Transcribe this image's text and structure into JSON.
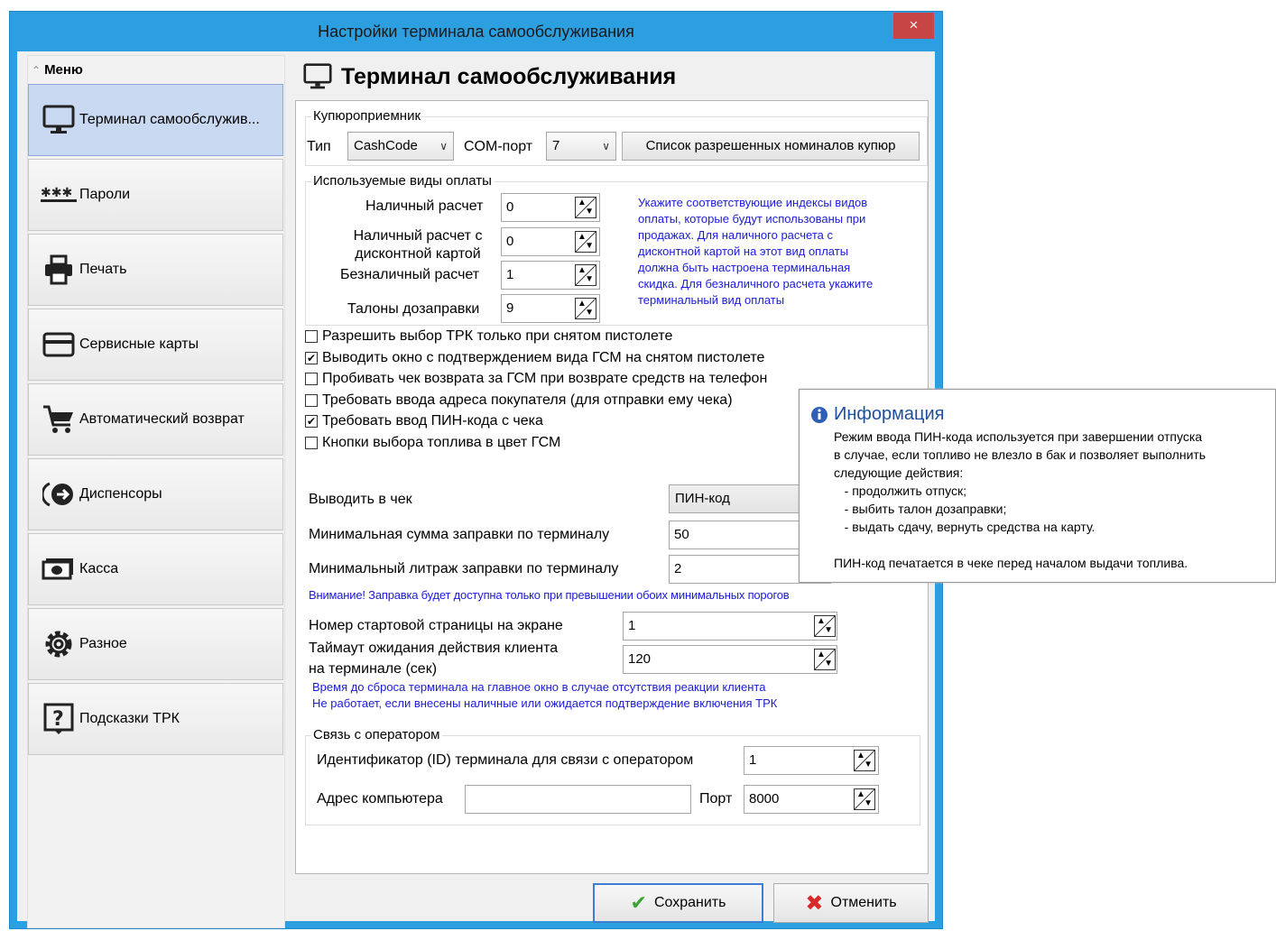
{
  "window": {
    "title": "Настройки терминала самообслуживания",
    "close_label": "×"
  },
  "sidebar": {
    "header": "Меню",
    "items": [
      {
        "label": "Терминал самообслужив...",
        "icon": "monitor-icon"
      },
      {
        "label": "Пароли",
        "icon": "password-icon"
      },
      {
        "label": "Печать",
        "icon": "printer-icon"
      },
      {
        "label": "Сервисные карты",
        "icon": "card-icon"
      },
      {
        "label": "Автоматический возврат",
        "icon": "cart-icon"
      },
      {
        "label": "Диспенсоры",
        "icon": "dispenser-icon"
      },
      {
        "label": "Касса",
        "icon": "money-icon"
      },
      {
        "label": "Разное",
        "icon": "gear-icon"
      },
      {
        "label": "Подсказки ТРК",
        "icon": "help-icon"
      }
    ]
  },
  "page": {
    "title": "Терминал самообслуживания"
  },
  "bill_acceptor": {
    "title": "Купюроприемник",
    "type_label": "Тип",
    "type_value": "CashCode",
    "com_label": "COM-порт",
    "com_value": "7",
    "denominations_button": "Список разрешенных номиналов купюр"
  },
  "payment_types": {
    "title": "Используемые виды оплаты",
    "rows": [
      {
        "label": "Наличный расчет",
        "value": "0"
      },
      {
        "label": "Наличный расчет с дисконтной картой",
        "value": "0"
      },
      {
        "label": "Безналичный расчет",
        "value": "1"
      },
      {
        "label": "Талоны дозаправки",
        "value": "9"
      }
    ],
    "note": "Укажите соответствующие индексы видов\nоплаты, которые будут использованы при\nпродажах. Для наличного расчета с\nдисконтной картой на этот вид оплаты\nдолжна быть настроена терминальная\nскидка. Для безналичного расчета укажите\nтерминальный вид оплаты"
  },
  "checkboxes": [
    {
      "label": "Разрешить выбор ТРК только при снятом пистолете",
      "checked": false
    },
    {
      "label": "Выводить окно с подтверждением вида ГСМ на снятом пистолете",
      "checked": true
    },
    {
      "label": "Пробивать чек возврата за ГСМ при возврате средств на телефон",
      "checked": false
    },
    {
      "label": "Требовать ввода адреса покупателя (для отправки ему чека)",
      "checked": false
    },
    {
      "label": "Требовать ввод ПИН-кода с чека",
      "checked": true
    },
    {
      "label": "Кнопки выбора топлива в цвет ГСМ",
      "checked": false
    }
  ],
  "receipt": {
    "label": "Выводить в чек",
    "value": "ПИН-код"
  },
  "min_sum": {
    "label": "Минимальная сумма заправки по терминалу",
    "value": "50"
  },
  "min_volume": {
    "label": "Минимальный литраж заправки по терминалу",
    "value": "2"
  },
  "min_note": "Внимание! Заправка будет доступна только при превышении обоих минимальных порогов",
  "start_page": {
    "label": "Номер стартовой страницы на экране",
    "value": "1"
  },
  "timeout": {
    "label_line1": "Таймаут ожидания действия клиента",
    "label_line2": "на терминале (сек)",
    "value": "120"
  },
  "timeout_note_1": "Время до сброса терминала на главное окно в случае отсутствия реакции клиента",
  "timeout_note_2": "Не работает, если внесены наличные или ожидается подтверждение включения ТРК",
  "operator": {
    "title": "Связь с оператором",
    "id_label": "Идентификатор (ID) терминала для связи с оператором",
    "id_value": "1",
    "address_label": "Адрес компьютера",
    "address_value": "",
    "port_label": "Порт",
    "port_value": "8000"
  },
  "buttons": {
    "save": "Сохранить",
    "cancel": "Отменить"
  },
  "tooltip": {
    "title": "Информация",
    "body": "Режим ввода ПИН-кода используется при завершении отпуска\nв случае, если топливо не влезло в бак и позволяет выполнить\nследующие действия:\n   - продолжить отпуск;\n   - выбить талон дозаправки;\n   - выдать сдачу, вернуть средства на карту.\n\nПИН-код печатается в чеке перед началом выдачи топлива."
  },
  "colors": {
    "titlebar": "#2c9fe0",
    "close": "#c74545",
    "note": "#1b1bd8",
    "active_menu": "#c9d9f1"
  }
}
